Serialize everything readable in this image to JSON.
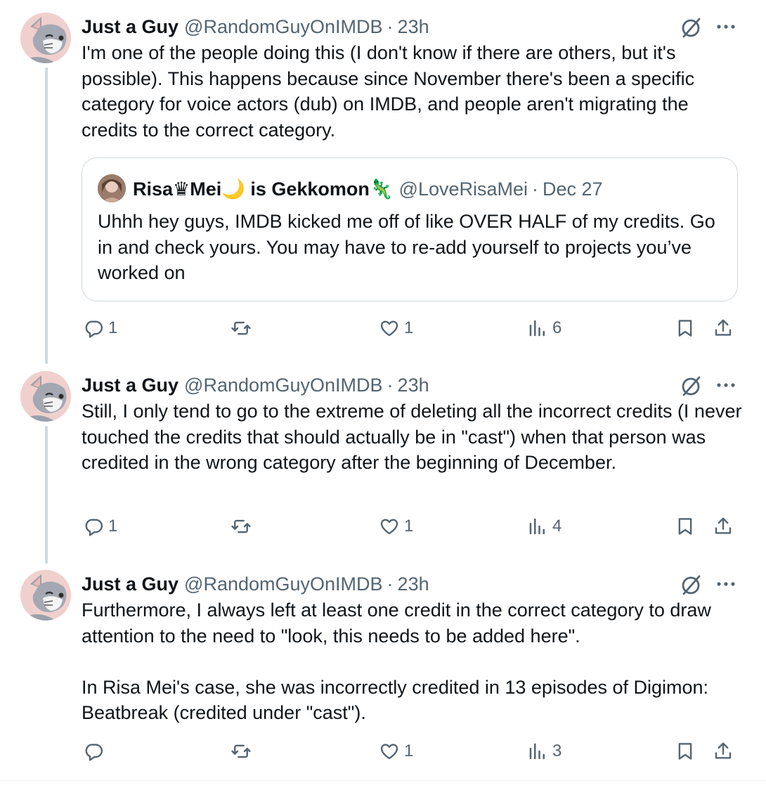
{
  "tweets": [
    {
      "name": "Just a Guy",
      "handle": "@RandomGuyOnIMDB",
      "sep": "·",
      "time": "23h",
      "paragraphs": [
        "I'm one of the people doing this (I don't know if there are others, but it's possible). This happens because since November there's been a specific category for voice actors (dub) on IMDB, and people aren't migrating the credits to the correct category."
      ],
      "quote": {
        "name": "Risa♛Mei🌙 is Gekkomon🦎",
        "handle": "@LoveRisaMei",
        "sep": "·",
        "time": "Dec 27",
        "text": "Uhhh hey guys, IMDB kicked me off of like OVER HALF of my credits. Go in and check yours. You may have to re-add yourself to projects you’ve worked on"
      },
      "replies": "1",
      "retweets": "",
      "likes": "1",
      "views": "6"
    },
    {
      "name": "Just a Guy",
      "handle": "@RandomGuyOnIMDB",
      "sep": "·",
      "time": "23h",
      "paragraphs": [
        "Still, I only tend to go to the extreme of deleting all the incorrect credits (I never touched the credits that should actually be in \"cast\") when that person was credited in the wrong category after the beginning of December."
      ],
      "replies": "1",
      "retweets": "",
      "likes": "1",
      "views": "4"
    },
    {
      "name": "Just a Guy",
      "handle": "@RandomGuyOnIMDB",
      "sep": "·",
      "time": "23h",
      "paragraphs": [
        "Furthermore, I always left at least one credit in the correct category to draw attention to the need to \"look, this needs to be added here\".",
        "In Risa Mei's case, she was incorrectly credited in 13 episodes of Digimon: Beatbreak (credited under \"cast\")."
      ],
      "replies": "",
      "retweets": "",
      "likes": "1",
      "views": "3"
    }
  ],
  "icons": {
    "reply": "reply-icon",
    "retweet": "retweet-icon",
    "like": "heart-icon",
    "views": "views-bar-chart-icon",
    "bookmark": "bookmark-icon",
    "share": "share-icon",
    "grok": "grok-icon",
    "more": "more-dots-icon"
  },
  "colors": {
    "text": "#0f1419",
    "secondary": "#536471",
    "border": "#cfd9de",
    "thread_line": "#cfd9de"
  }
}
